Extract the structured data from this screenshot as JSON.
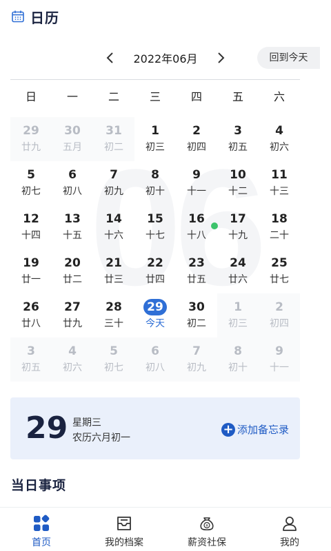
{
  "header": {
    "title": "日历",
    "icon": "calendar-icon"
  },
  "month_bar": {
    "month_label": "2022年06月",
    "today_button": "回到今天"
  },
  "weekdays": [
    "日",
    "一",
    "二",
    "三",
    "四",
    "五",
    "六"
  ],
  "watermark": "06",
  "colors": {
    "accent": "#2f6fd6",
    "event_dot": "#3cc36b",
    "muted": "#b8bcc4"
  },
  "days": [
    {
      "d": "29",
      "l": "廿九",
      "other": true
    },
    {
      "d": "30",
      "l": "五月",
      "other": true
    },
    {
      "d": "31",
      "l": "初二",
      "other": true
    },
    {
      "d": "1",
      "l": "初三"
    },
    {
      "d": "2",
      "l": "初四"
    },
    {
      "d": "3",
      "l": "初五"
    },
    {
      "d": "4",
      "l": "初六"
    },
    {
      "d": "5",
      "l": "初七"
    },
    {
      "d": "6",
      "l": "初八"
    },
    {
      "d": "7",
      "l": "初九"
    },
    {
      "d": "8",
      "l": "初十"
    },
    {
      "d": "9",
      "l": "十一"
    },
    {
      "d": "10",
      "l": "十二"
    },
    {
      "d": "11",
      "l": "十三"
    },
    {
      "d": "12",
      "l": "十四"
    },
    {
      "d": "13",
      "l": "十五"
    },
    {
      "d": "14",
      "l": "十六"
    },
    {
      "d": "15",
      "l": "十七"
    },
    {
      "d": "16",
      "l": "十八",
      "event": true
    },
    {
      "d": "17",
      "l": "十九"
    },
    {
      "d": "18",
      "l": "二十"
    },
    {
      "d": "19",
      "l": "廿一"
    },
    {
      "d": "20",
      "l": "廿二"
    },
    {
      "d": "21",
      "l": "廿三"
    },
    {
      "d": "22",
      "l": "廿四"
    },
    {
      "d": "23",
      "l": "廿五"
    },
    {
      "d": "24",
      "l": "廿六"
    },
    {
      "d": "25",
      "l": "廿七"
    },
    {
      "d": "26",
      "l": "廿八"
    },
    {
      "d": "27",
      "l": "廿九"
    },
    {
      "d": "28",
      "l": "三十"
    },
    {
      "d": "29",
      "l": "今天",
      "today": true
    },
    {
      "d": "30",
      "l": "初二"
    },
    {
      "d": "1",
      "l": "初三",
      "other": true
    },
    {
      "d": "2",
      "l": "初四",
      "other": true
    },
    {
      "d": "3",
      "l": "初五",
      "other": true
    },
    {
      "d": "4",
      "l": "初六",
      "other": true
    },
    {
      "d": "5",
      "l": "初七",
      "other": true
    },
    {
      "d": "6",
      "l": "初八",
      "other": true
    },
    {
      "d": "7",
      "l": "初九",
      "other": true
    },
    {
      "d": "8",
      "l": "初十",
      "other": true
    },
    {
      "d": "9",
      "l": "十一",
      "other": true
    }
  ],
  "selected_day": {
    "day": "29",
    "weekday": "星期三",
    "lunar": "农历六月初一",
    "add_memo": "添加备忘录"
  },
  "section": {
    "title": "当日事项"
  },
  "tabbar": [
    {
      "label": "首页",
      "icon": "home-grid-icon",
      "active": true
    },
    {
      "label": "我的档案",
      "icon": "archive-tray-icon"
    },
    {
      "label": "薪资社保",
      "icon": "money-bag-icon"
    },
    {
      "label": "我的",
      "icon": "user-profile-icon"
    }
  ]
}
